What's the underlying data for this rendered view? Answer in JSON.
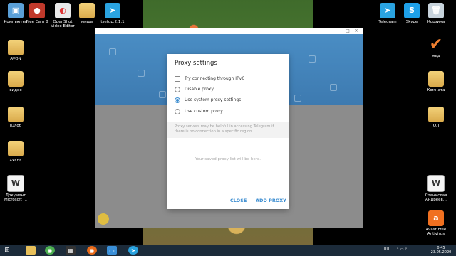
{
  "desktop_left": [
    {
      "label": "Компьютер",
      "icon": "computer-icon"
    },
    {
      "label": "AVON",
      "icon": "folder-icon"
    },
    {
      "label": "видео",
      "icon": "folder-icon"
    },
    {
      "label": "Юлоб",
      "icon": "folder-icon"
    },
    {
      "label": "хуяня",
      "icon": "folder-icon"
    },
    {
      "label": "Документ Microsoft ...",
      "icon": "document-icon"
    }
  ],
  "desktop_top": [
    {
      "label": "Free Cam 8",
      "icon": "free-cam-icon"
    },
    {
      "label": "OpenShot Video Editor",
      "icon": "openshot-icon"
    },
    {
      "label": "миша",
      "icon": "folder-icon"
    },
    {
      "label": "tsetup.2.1.1",
      "icon": "telegram-setup-icon"
    }
  ],
  "desktop_right": [
    {
      "label": "Telegram",
      "icon": "telegram-icon"
    },
    {
      "label": "Skype",
      "icon": "skype-icon"
    },
    {
      "label": "Корзина",
      "icon": "recycle-bin-icon"
    },
    {
      "label": "мед",
      "icon": "checkmark-icon"
    },
    {
      "label": "Комната",
      "icon": "folder-icon"
    },
    {
      "label": "ОЛ",
      "icon": "folder-icon"
    },
    {
      "label": "Станислав Андреев...",
      "icon": "document-icon"
    },
    {
      "label": "Avast Free Antivirus",
      "icon": "avast-icon"
    }
  ],
  "proxy_dialog": {
    "title": "Proxy settings",
    "ipv6_label": "Try connecting through IPv6",
    "options": [
      {
        "label": "Disable proxy",
        "selected": false
      },
      {
        "label": "Use system proxy settings",
        "selected": true
      },
      {
        "label": "Use custom proxy",
        "selected": false
      }
    ],
    "info_text": "Proxy servers may be helpful in accessing Telegram if there is no connection in a specific region.",
    "empty_text": "Your saved proxy list will be here.",
    "close_label": "CLOSE",
    "add_label": "ADD PROXY"
  },
  "taskbar": {
    "lang": "RU",
    "time": "0:45",
    "date": "23.05.2020"
  },
  "colors": {
    "accent": "#3d8ed1",
    "tg_header": "#4a8dc4",
    "taskbar": "#1c2b3a"
  }
}
